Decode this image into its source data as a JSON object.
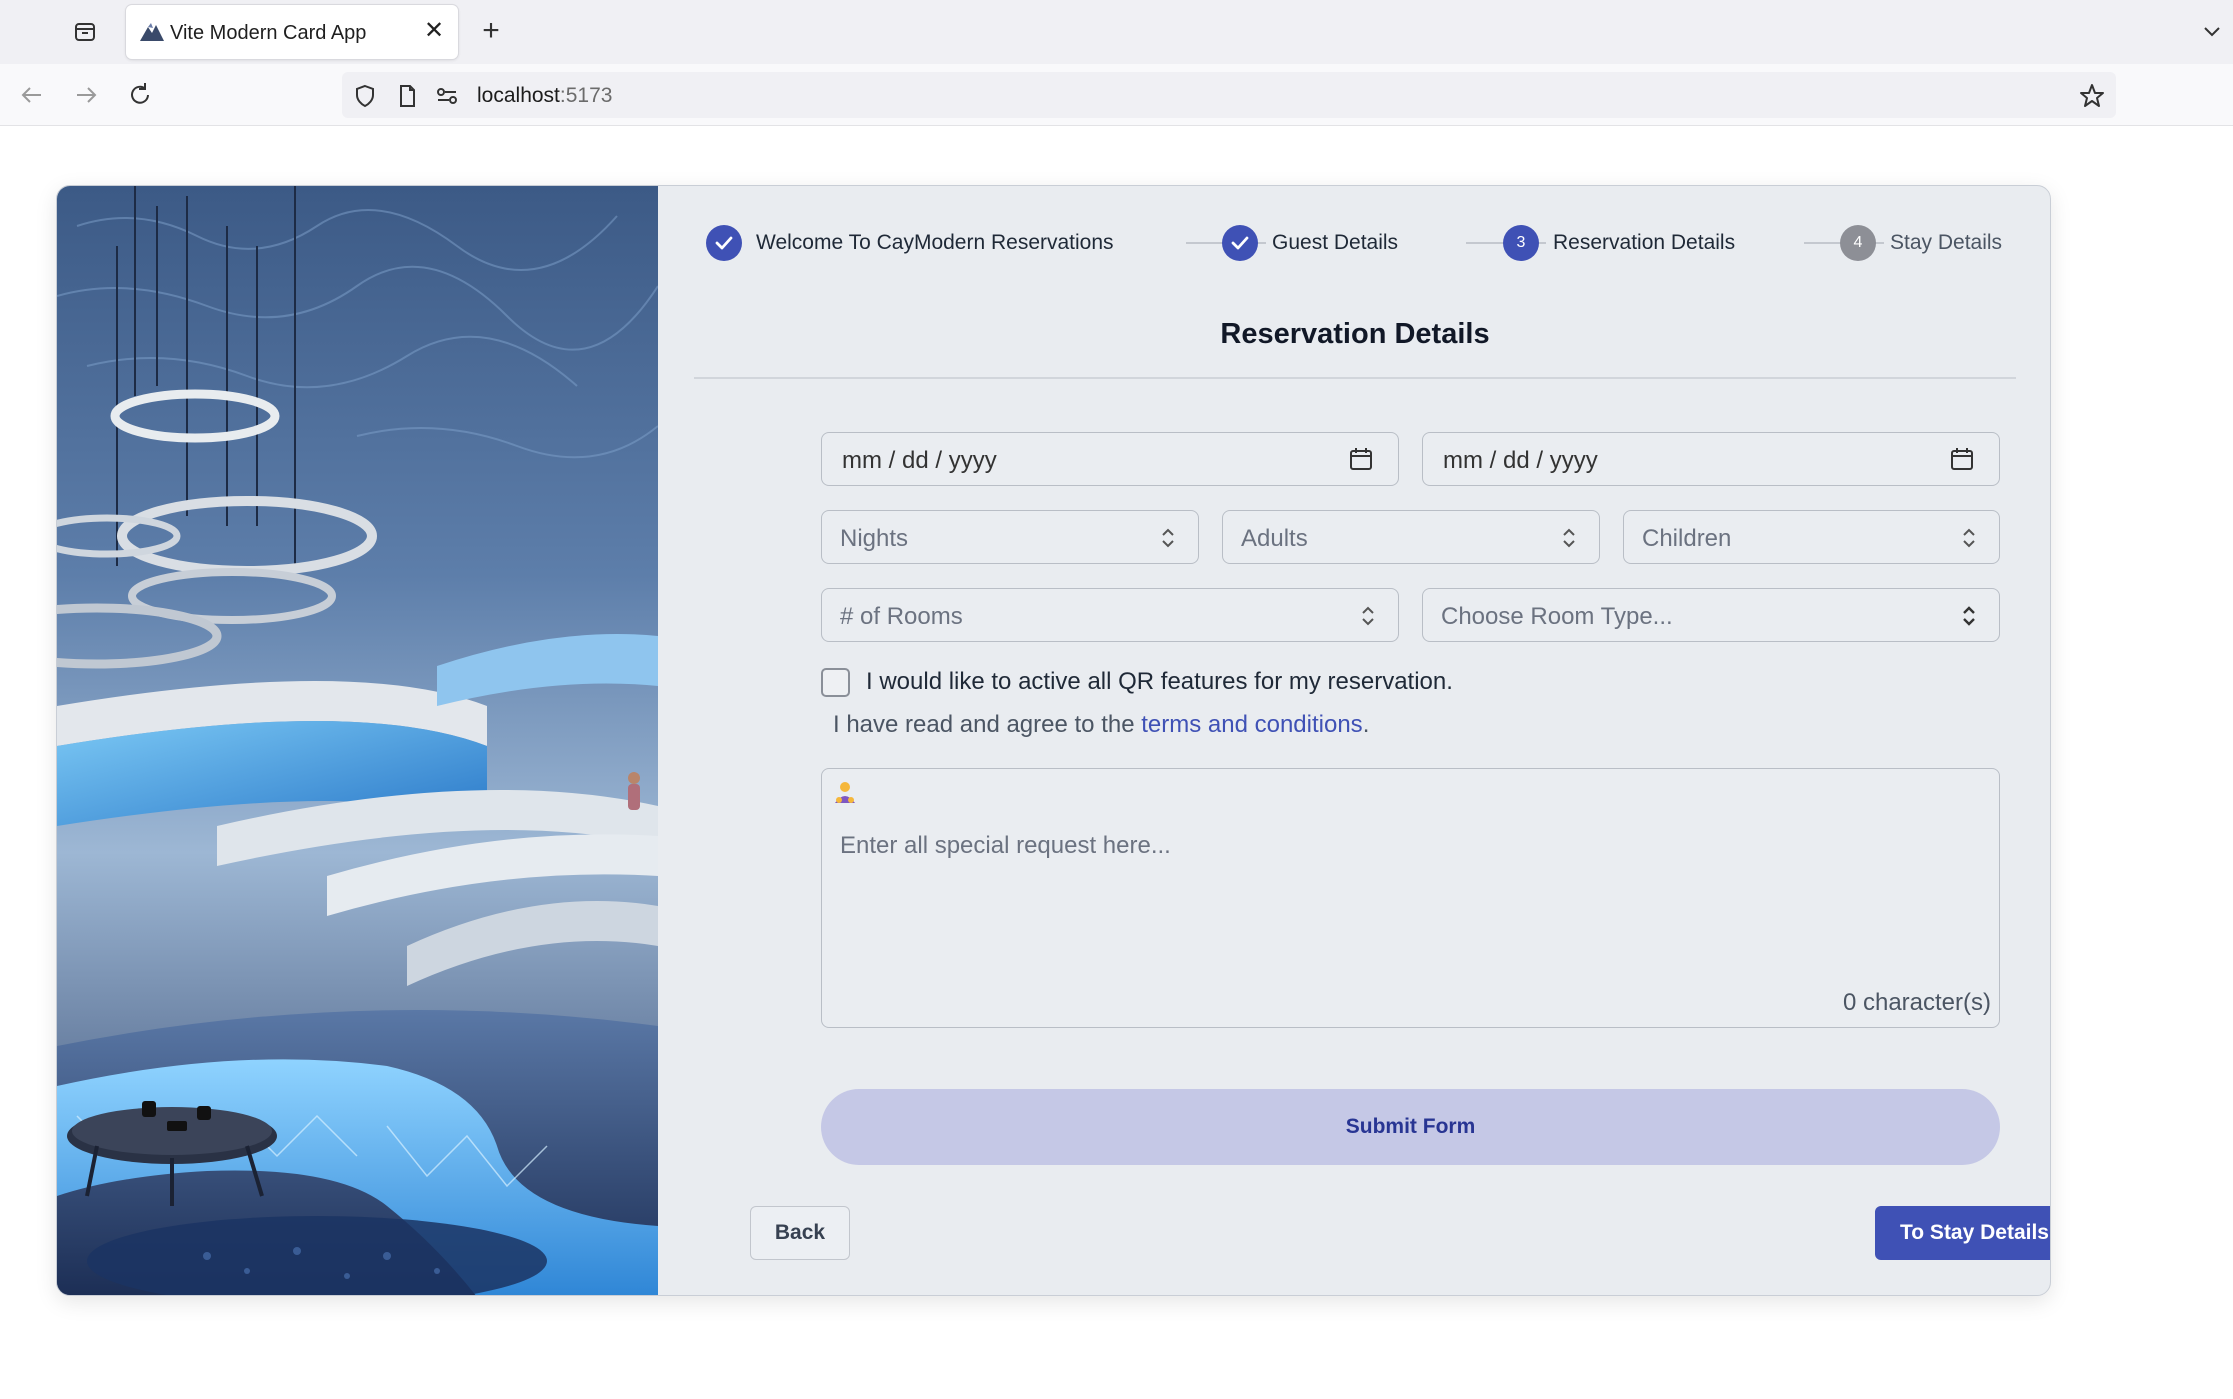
{
  "browser": {
    "tab_title": "Vite Modern Card App",
    "url_host": "localhost",
    "url_port": ":5173"
  },
  "stepper": {
    "steps": [
      {
        "label": "Welcome To CayModern Reservations",
        "state": "done",
        "number": ""
      },
      {
        "label": "Guest Details",
        "state": "done",
        "number": ""
      },
      {
        "label": "Reservation Details",
        "state": "active",
        "number": "3"
      },
      {
        "label": "Stay Details",
        "state": "pending",
        "number": "4"
      }
    ]
  },
  "form": {
    "heading": "Reservation Details",
    "checkin_date": "mm / dd / yyyy",
    "checkout_date": "mm / dd / yyyy",
    "nights_placeholder": "Nights",
    "adults_placeholder": "Adults",
    "children_placeholder": "Children",
    "rooms_placeholder": "# of Rooms",
    "room_type_placeholder": "Choose Room Type...",
    "qr_label": "I would like to active all QR features for my reservation.",
    "terms_prefix": "I have read and agree to the ",
    "terms_link": "terms and conditions",
    "terms_suffix": ".",
    "request_placeholder": "Enter all special request here...",
    "char_count": "0 character(s)",
    "submit_label": "Submit Form"
  },
  "footer": {
    "back_label": "Back",
    "next_label": "To Stay Details"
  },
  "colors": {
    "primary": "#3f51b5",
    "submit_bg": "#c5c8e6",
    "panel_bg": "#e9ecf0"
  }
}
